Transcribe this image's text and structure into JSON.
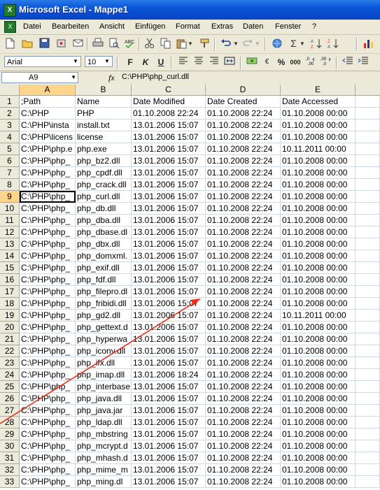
{
  "app": {
    "title": "Microsoft Excel - Mappe1"
  },
  "menu": [
    "Datei",
    "Bearbeiten",
    "Ansicht",
    "Einfügen",
    "Format",
    "Extras",
    "Daten",
    "Fenster",
    "?"
  ],
  "format_toolbar": {
    "font": "Arial",
    "size": "10",
    "bold": "F",
    "italic": "K",
    "underline": "U",
    "percent": "%",
    "thousands": "000"
  },
  "formula_bar": {
    "name_box": "A9",
    "fx": "fx",
    "value": "C:\\PHP\\php_curl.dll"
  },
  "active_cell": {
    "column": "A",
    "row": 9
  },
  "columns": [
    "A",
    "B",
    "C",
    "D",
    "E"
  ],
  "rows": [
    {
      "n": "1",
      "a": ";Path",
      "b": "Name",
      "c": "Date Modified",
      "d": "Date Created",
      "e": "Date Accessed"
    },
    {
      "n": "2",
      "a": "C:\\PHP",
      "b": "PHP",
      "c": "01.10.2008 22:24",
      "d": "01.10.2008 22:24",
      "e": "01.10.2008 00:00"
    },
    {
      "n": "3",
      "a": "C:\\PHP\\insta",
      "b": "install.txt",
      "c": "13.01.2006 15:07",
      "d": "01.10.2008 22:24",
      "e": "01.10.2008 00:00"
    },
    {
      "n": "4",
      "a": "C:\\PHP\\licens",
      "b": "license",
      "c": "13.01.2006 15:07",
      "d": "01.10.2008 22:24",
      "e": "01.10.2008 00:00"
    },
    {
      "n": "5",
      "a": "C:\\PHP\\php.e",
      "b": "php.exe",
      "c": "13.01.2006 15:07",
      "d": "01.10.2008 22:24",
      "e": "10.11.2011 00:00"
    },
    {
      "n": "6",
      "a": "C:\\PHP\\php_",
      "b": "php_bz2.dll",
      "c": "13.01.2006 15:07",
      "d": "01.10.2008 22:24",
      "e": "01.10.2008 00:00"
    },
    {
      "n": "7",
      "a": "C:\\PHP\\php_",
      "b": "php_cpdf.dll",
      "c": "13.01.2006 15:07",
      "d": "01.10.2008 22:24",
      "e": "01.10.2008 00:00"
    },
    {
      "n": "8",
      "a": "C:\\PHP\\php_",
      "b": "php_crack.dll",
      "c": "13.01.2006 15:07",
      "d": "01.10.2008 22:24",
      "e": "01.10.2008 00:00"
    },
    {
      "n": "9",
      "a": "C:\\PHP\\php_",
      "b": "php_curl.dll",
      "c": "13.01.2006 15:07",
      "d": "01.10.2008 22:24",
      "e": "01.10.2008 00:00"
    },
    {
      "n": "10",
      "a": "C:\\PHP\\php_",
      "b": "php_db.dll",
      "c": "13.01.2006 15:07",
      "d": "01.10.2008 22:24",
      "e": "01.10.2008 00:00"
    },
    {
      "n": "11",
      "a": "C:\\PHP\\php_",
      "b": "php_dba.dll",
      "c": "13.01.2006 15:07",
      "d": "01.10.2008 22:24",
      "e": "01.10.2008 00:00"
    },
    {
      "n": "12",
      "a": "C:\\PHP\\php_",
      "b": "php_dbase.dl",
      "c": "13.01.2006 15:07",
      "d": "01.10.2008 22:24",
      "e": "01.10.2008 00:00"
    },
    {
      "n": "13",
      "a": "C:\\PHP\\php_",
      "b": "php_dbx.dll",
      "c": "13.01.2006 15:07",
      "d": "01.10.2008 22:24",
      "e": "01.10.2008 00:00"
    },
    {
      "n": "14",
      "a": "C:\\PHP\\php_",
      "b": "php_domxml.",
      "c": "13.01.2006 15:07",
      "d": "01.10.2008 22:24",
      "e": "01.10.2008 00:00"
    },
    {
      "n": "15",
      "a": "C:\\PHP\\php_",
      "b": "php_exif.dll",
      "c": "13.01.2006 15:07",
      "d": "01.10.2008 22:24",
      "e": "01.10.2008 00:00"
    },
    {
      "n": "16",
      "a": "C:\\PHP\\php_",
      "b": "php_fdf.dll",
      "c": "13.01.2006 15:07",
      "d": "01.10.2008 22:24",
      "e": "01.10.2008 00:00"
    },
    {
      "n": "17",
      "a": "C:\\PHP\\php_",
      "b": "php_filepro.dl",
      "c": "13.01.2006 15:07",
      "d": "01.10.2008 22:24",
      "e": "01.10.2008 00:00"
    },
    {
      "n": "18",
      "a": "C:\\PHP\\php_",
      "b": "php_fribidi.dll",
      "c": "13.01.2006 15:07",
      "d": "01.10.2008 22:24",
      "e": "01.10.2008 00:00"
    },
    {
      "n": "19",
      "a": "C:\\PHP\\php_",
      "b": "php_gd2.dll",
      "c": "13.01.2006 15:07",
      "d": "01.10.2008 22:24",
      "e": "10.11.2011 00:00"
    },
    {
      "n": "20",
      "a": "C:\\PHP\\php_",
      "b": "php_gettext.d",
      "c": "13.01.2006 15:07",
      "d": "01.10.2008 22:24",
      "e": "01.10.2008 00:00"
    },
    {
      "n": "21",
      "a": "C:\\PHP\\php_",
      "b": "php_hyperwa",
      "c": "13.01.2006 15:07",
      "d": "01.10.2008 22:24",
      "e": "01.10.2008 00:00"
    },
    {
      "n": "22",
      "a": "C:\\PHP\\php_",
      "b": "php_iconv.dll",
      "c": "13.01.2006 15:07",
      "d": "01.10.2008 22:24",
      "e": "01.10.2008 00:00"
    },
    {
      "n": "23",
      "a": "C:\\PHP\\php_",
      "b": "php_ifx.dll",
      "c": "13.01.2006 15:07",
      "d": "01.10.2008 22:24",
      "e": "01.10.2008 00:00"
    },
    {
      "n": "24",
      "a": "C:\\PHP\\php_",
      "b": "php_imap.dll",
      "c": "13.01.2006 18:24",
      "d": "01.10.2008 22:24",
      "e": "01.10.2008 00:00"
    },
    {
      "n": "25",
      "a": "C:\\PHP\\php_",
      "b": "php_interbase",
      "c": "13.01.2006 15:07",
      "d": "01.10.2008 22:24",
      "e": "01.10.2008 00:00"
    },
    {
      "n": "26",
      "a": "C:\\PHP\\php_",
      "b": "php_java.dll",
      "c": "13.01.2006 15:07",
      "d": "01.10.2008 22:24",
      "e": "01.10.2008 00:00"
    },
    {
      "n": "27",
      "a": "C:\\PHP\\php_",
      "b": "php_java.jar",
      "c": "13.01.2006 15:07",
      "d": "01.10.2008 22:24",
      "e": "01.10.2008 00:00"
    },
    {
      "n": "28",
      "a": "C:\\PHP\\php_",
      "b": "php_ldap.dll",
      "c": "13.01.2006 15:07",
      "d": "01.10.2008 22:24",
      "e": "01.10.2008 00:00"
    },
    {
      "n": "29",
      "a": "C:\\PHP\\php_",
      "b": "php_mbstring",
      "c": "13.01.2006 15:07",
      "d": "01.10.2008 22:24",
      "e": "01.10.2008 00:00"
    },
    {
      "n": "30",
      "a": "C:\\PHP\\php_",
      "b": "php_mcrypt.d",
      "c": "13.01.2006 15:07",
      "d": "01.10.2008 22:24",
      "e": "01.10.2008 00:00"
    },
    {
      "n": "31",
      "a": "C:\\PHP\\php_",
      "b": "php_mhash.d",
      "c": "13.01.2006 15:07",
      "d": "01.10.2008 22:24",
      "e": "01.10.2008 00:00"
    },
    {
      "n": "32",
      "a": "C:\\PHP\\php_",
      "b": "php_mime_m",
      "c": "13.01.2006 15:07",
      "d": "01.10.2008 22:24",
      "e": "01.10.2008 00:00"
    },
    {
      "n": "33",
      "a": "C:\\PHP\\php_",
      "b": "php_ming.dl",
      "c": "13.01.2006 15:07",
      "d": "01.10.2008 22:24",
      "e": "01.10.2008 00:00"
    }
  ],
  "colors": {
    "title_bar": "#0a55d8",
    "chrome": "#ece9d8",
    "header_selected": "#ffd58c",
    "arrow": "#e8301c"
  }
}
